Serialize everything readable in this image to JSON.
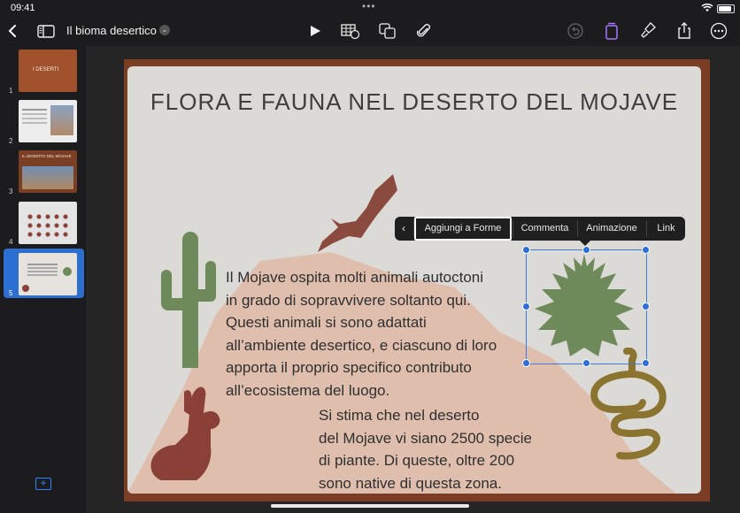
{
  "status": {
    "time": "09:41"
  },
  "toolbar": {
    "back_icon": "chevron-left-icon",
    "doc_title": "Il bioma desertico",
    "icons": [
      "sidebar-icon",
      "play-icon",
      "table-icon",
      "shapes-icon",
      "attachment-icon",
      "undo-icon",
      "format-icon",
      "paintbrush-icon",
      "share-icon",
      "more-icon"
    ],
    "accent": "#a974ff"
  },
  "slides": [
    {
      "number": "1",
      "title": "I DESERTI"
    },
    {
      "number": "2"
    },
    {
      "number": "3",
      "title": "IL DESERTO DEL MOJAVE"
    },
    {
      "number": "4"
    },
    {
      "number": "5",
      "selected": true
    }
  ],
  "slide": {
    "title": "FLORA E FAUNA NEL DESERTO DEL MOJAVE",
    "paragraph1": [
      "Il Mojave ospita molti animali autoctoni",
      "in grado di sopravvivere soltanto qui.",
      "Questi animali si sono adattati",
      "all’ambiente desertico, e ciascuno di loro",
      "apporta il proprio specifico contributo",
      "all’ecosistema del luogo."
    ],
    "paragraph2": [
      "Si stima che nel deserto",
      "del Mojave vi siano 2500 specie",
      "di piante. Di queste, oltre 200",
      "sono native di questa zona."
    ]
  },
  "popup_menu": {
    "items": [
      "Aggiungi a Forme",
      "Commenta",
      "Animazione",
      "Link"
    ],
    "active_index": 0
  },
  "colors": {
    "frame": "#7b3d24",
    "slide_bg": "#dcdad6",
    "cactus": "#6f8a5a",
    "bird": "#8a4a3e",
    "rabbit": "#8a3f37",
    "snake": "#8b7430",
    "selection": "#2d6fd6"
  }
}
